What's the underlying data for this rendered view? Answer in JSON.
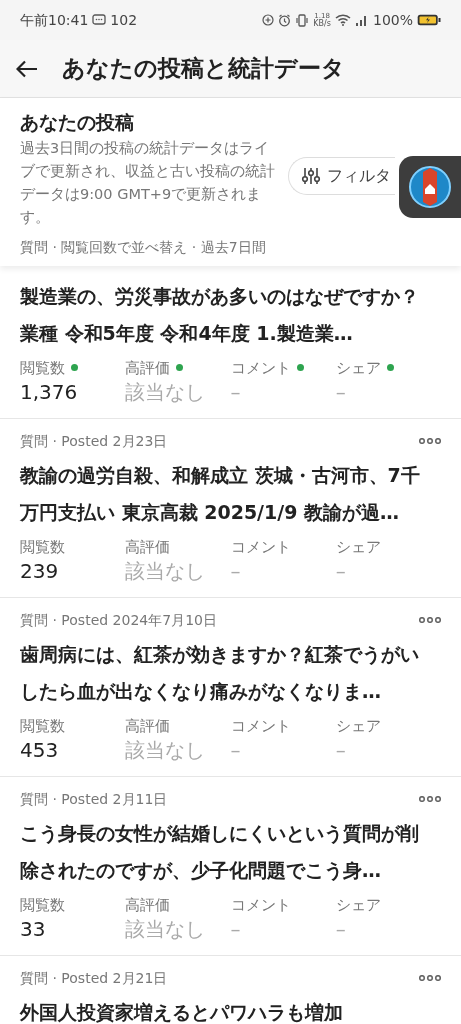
{
  "status_bar": {
    "time": "午前10:41",
    "notification_count": "102",
    "speed": "1.18",
    "speed_unit": "KB/s",
    "battery": "100%"
  },
  "header": {
    "title": "あなたの投稿と統計データ"
  },
  "summary": {
    "title": "あなたの投稿",
    "description": "過去3日間の投稿の統計データはライブで更新され、収益と古い投稿の統計データは9:00 GMT+9で更新されます。",
    "filter_label": "フィルタ",
    "sort_line": "質問 · 閲覧回数で並べ替え · 過去7日間"
  },
  "posts": [
    {
      "title": "製造業の、労災事故があ多いのはなぜですか？業種 令和5年度 令和4年度 1.製造業…",
      "stats": [
        {
          "label": "閲覧数",
          "value": "1,376",
          "live": true,
          "muted": false
        },
        {
          "label": "高評価",
          "value": "該当なし",
          "live": true,
          "muted": true
        },
        {
          "label": "コメント",
          "value": "–",
          "live": true,
          "muted": true
        },
        {
          "label": "シェア",
          "value": "–",
          "live": true,
          "muted": true
        }
      ]
    },
    {
      "meta": "質問 · Posted 2月23日",
      "title": "教諭の過労自殺、和解成立 茨城・古河市、7千万円支払い 東京高裁 2025/1/9 教諭が過…",
      "stats": [
        {
          "label": "閲覧数",
          "value": "239",
          "live": false,
          "muted": false
        },
        {
          "label": "高評価",
          "value": "該当なし",
          "live": false,
          "muted": true
        },
        {
          "label": "コメント",
          "value": "–",
          "live": false,
          "muted": true
        },
        {
          "label": "シェア",
          "value": "–",
          "live": false,
          "muted": true
        }
      ]
    },
    {
      "meta": "質問 · Posted 2024年7月10日",
      "title": "歯周病には、紅茶が効きますか？紅茶でうがいしたら血が出なくなり痛みがなくなりま…",
      "stats": [
        {
          "label": "閲覧数",
          "value": "453",
          "live": false,
          "muted": false
        },
        {
          "label": "高評価",
          "value": "該当なし",
          "live": false,
          "muted": true
        },
        {
          "label": "コメント",
          "value": "–",
          "live": false,
          "muted": true
        },
        {
          "label": "シェア",
          "value": "–",
          "live": false,
          "muted": true
        }
      ]
    },
    {
      "meta": "質問 · Posted 2月11日",
      "title": "こう身長の女性が結婚しにくいという質問が削除されたのですが、少子化問題でこう身…",
      "stats": [
        {
          "label": "閲覧数",
          "value": "33",
          "live": false,
          "muted": false
        },
        {
          "label": "高評価",
          "value": "該当なし",
          "live": false,
          "muted": true
        },
        {
          "label": "コメント",
          "value": "–",
          "live": false,
          "muted": true
        },
        {
          "label": "シェア",
          "value": "–",
          "live": false,
          "muted": true
        }
      ]
    },
    {
      "meta": "質問 · Posted 2月21日",
      "title": "外国人投資家増えるとパワハラも増加"
    }
  ]
}
